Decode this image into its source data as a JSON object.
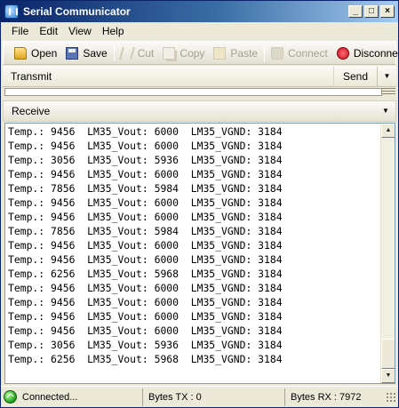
{
  "window": {
    "title": "Serial Communicator",
    "min_glyph": "_",
    "max_glyph": "□",
    "close_glyph": "×"
  },
  "menu": [
    "File",
    "Edit",
    "View",
    "Help"
  ],
  "toolbar": {
    "open": "Open",
    "save": "Save",
    "cut": "Cut",
    "copy": "Copy",
    "paste": "Paste",
    "connect": "Connect",
    "disconnect": "Disconnect"
  },
  "transmit": {
    "label": "Transmit",
    "send_label": "Send",
    "input_value": ""
  },
  "receive": {
    "label": "Receive",
    "lines": [
      "Temp.: 9456  LM35_Vout: 6000  LM35_VGND: 3184",
      "Temp.: 9456  LM35_Vout: 6000  LM35_VGND: 3184",
      "Temp.: 3056  LM35_Vout: 5936  LM35_VGND: 3184",
      "Temp.: 9456  LM35_Vout: 6000  LM35_VGND: 3184",
      "Temp.: 7856  LM35_Vout: 5984  LM35_VGND: 3184",
      "Temp.: 9456  LM35_Vout: 6000  LM35_VGND: 3184",
      "Temp.: 9456  LM35_Vout: 6000  LM35_VGND: 3184",
      "Temp.: 7856  LM35_Vout: 5984  LM35_VGND: 3184",
      "Temp.: 9456  LM35_Vout: 6000  LM35_VGND: 3184",
      "Temp.: 9456  LM35_Vout: 6000  LM35_VGND: 3184",
      "Temp.: 6256  LM35_Vout: 5968  LM35_VGND: 3184",
      "Temp.: 9456  LM35_Vout: 6000  LM35_VGND: 3184",
      "Temp.: 9456  LM35_Vout: 6000  LM35_VGND: 3184",
      "Temp.: 9456  LM35_Vout: 6000  LM35_VGND: 3184",
      "Temp.: 9456  LM35_Vout: 6000  LM35_VGND: 3184",
      "Temp.: 3056  LM35_Vout: 5936  LM35_VGND: 3184",
      "Temp.: 6256  LM35_Vout: 5968  LM35_VGND: 3184"
    ]
  },
  "status": {
    "connection": "Connected...",
    "bytes_tx": "Bytes TX : 0",
    "bytes_rx": "Bytes RX : 7972"
  }
}
